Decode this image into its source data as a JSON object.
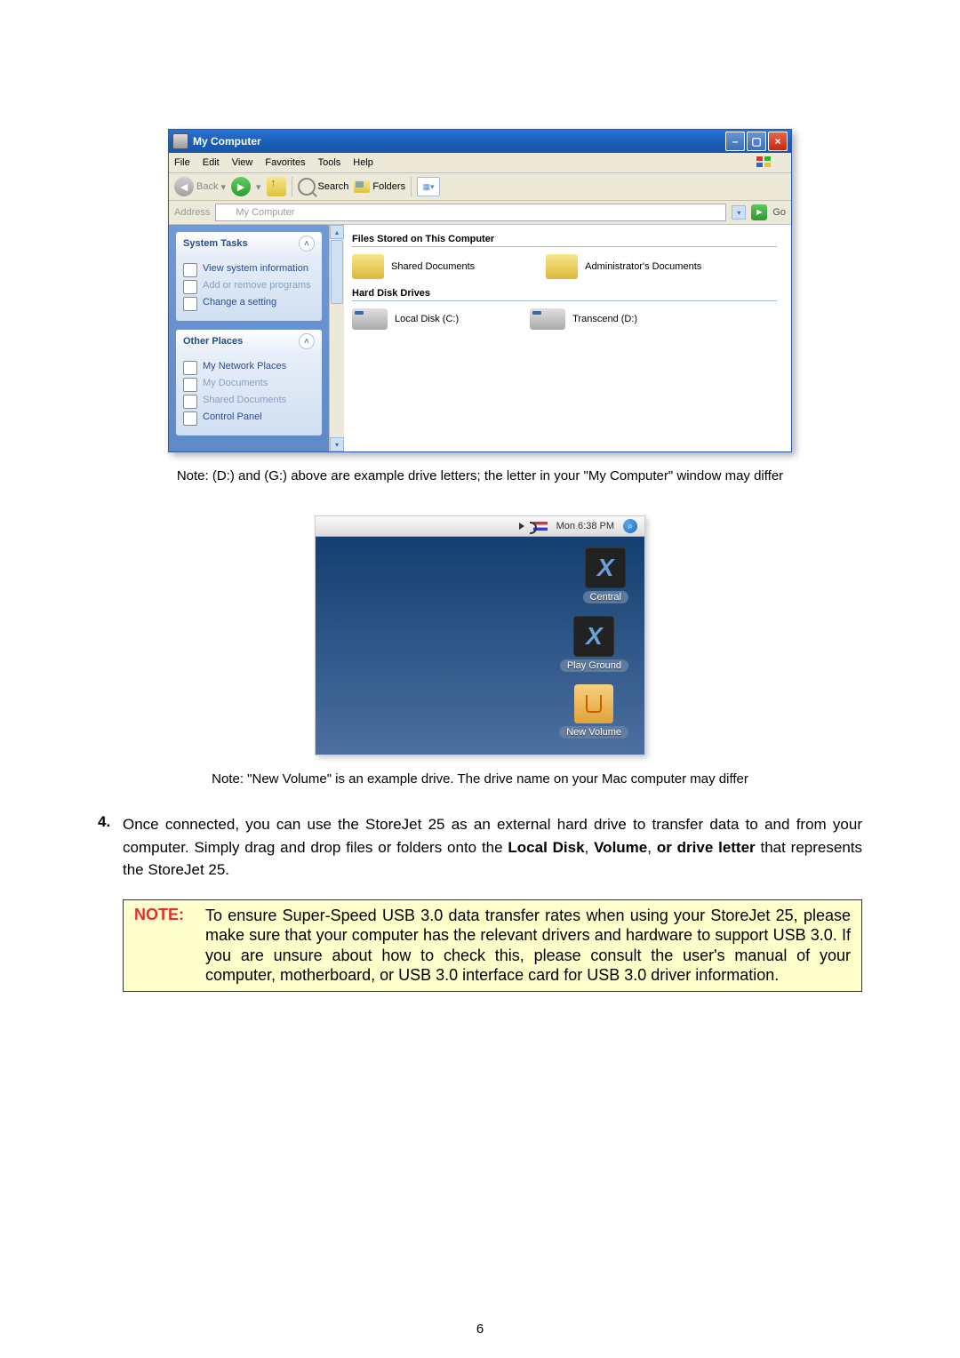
{
  "xp": {
    "title": "My Computer",
    "menubar": {
      "file": "File",
      "edit": "Edit",
      "view": "View",
      "favorites": "Favorites",
      "tools": "Tools",
      "help": "Help"
    },
    "toolbar": {
      "back_label": "Back",
      "search_label": "Search",
      "folders_label": "Folders"
    },
    "addressbar": {
      "label": "Address",
      "value": "My Computer",
      "go_label": "Go"
    },
    "sidebar": {
      "system_tasks": {
        "title": "System Tasks",
        "items": [
          "View system information",
          "Add or remove programs",
          "Change a setting"
        ]
      },
      "other_places": {
        "title": "Other Places",
        "items": [
          "My Network Places",
          "My Documents",
          "Shared Documents",
          "Control Panel"
        ]
      }
    },
    "main": {
      "section1": "Files Stored on This Computer",
      "item1": "Shared Documents",
      "item2": "Administrator's Documents",
      "section2": "Hard Disk Drives",
      "drive1": "Local Disk (C:)",
      "drive2": "Transcend (D:)"
    }
  },
  "note1": "Note: (D:) and (G:) above are example drive letters; the letter in your \"My Computer\" window may differ",
  "mac": {
    "clock": "Mon 6:38 PM",
    "drives": {
      "d1": "Central",
      "d2": "Play Ground",
      "d3": "New Volume"
    }
  },
  "note2": "Note: \"New Volume\" is an example drive. The drive name on your Mac computer may differ",
  "instruction": {
    "num": "4.",
    "text_pre": "Once connected, you can use the StoreJet 25 as an external hard drive to transfer data to and from your computer. Simply drag and drop files or folders onto the ",
    "strong1": "Local Disk",
    "sep1": ", ",
    "strong2": "Volume",
    "sep2": ", ",
    "strong3": "or drive letter",
    "text_post": " that represents the StoreJet 25."
  },
  "notebox": {
    "key": "NOTE:",
    "body": "To ensure Super-Speed USB 3.0 data transfer rates when using your StoreJet 25, please make sure that your computer has the relevant drivers and hardware to support USB 3.0. If you are unsure about how to check this, please consult the user's manual of your computer, motherboard, or USB 3.0 interface card for USB 3.0 driver information."
  },
  "page_number": "6"
}
